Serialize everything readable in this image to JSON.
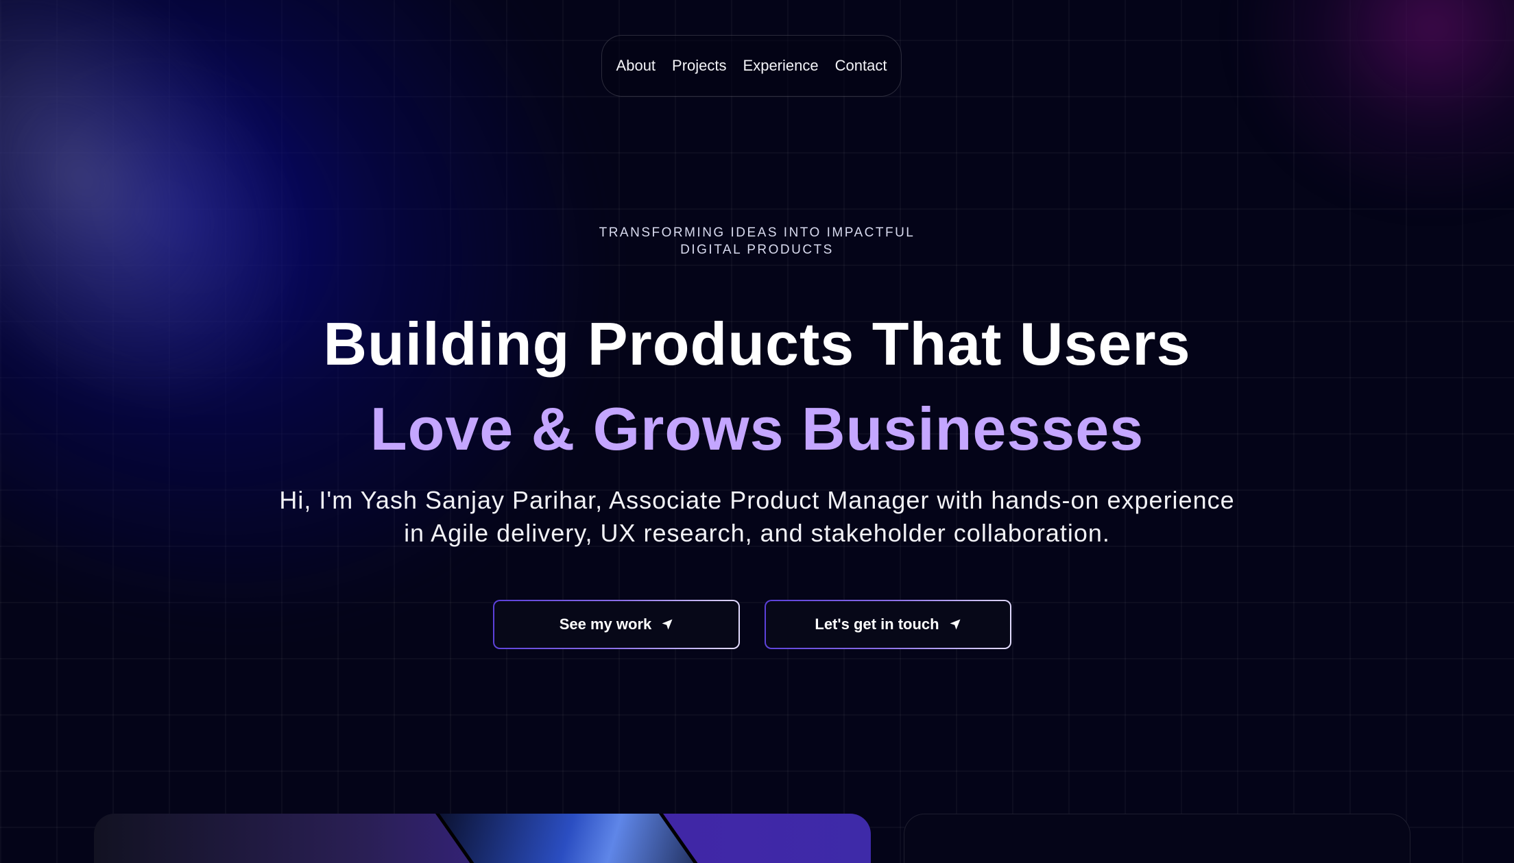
{
  "nav": {
    "items": [
      {
        "label": "About"
      },
      {
        "label": "Projects"
      },
      {
        "label": "Experience"
      },
      {
        "label": "Contact"
      }
    ]
  },
  "hero": {
    "kicker_line1": "TRANSFORMING IDEAS INTO IMPACTFUL",
    "kicker_line2": "DIGITAL PRODUCTS",
    "headline_line1": "Building Products That Users",
    "headline_line2": "Love & Grows Businesses",
    "intro": "Hi, I'm Yash Sanjay Parihar, Associate Product Manager with hands-on experience in Agile delivery, UX research, and stakeholder collaboration."
  },
  "buttons": {
    "see_work": "See my work",
    "get_in_touch": "Let's get in touch",
    "icon": "send-arrow-icon"
  },
  "colors": {
    "background": "#040418",
    "accent_purple": "#c4a6ff",
    "button_border_start": "#5a3fd9",
    "button_border_end": "#e6e0ff"
  }
}
